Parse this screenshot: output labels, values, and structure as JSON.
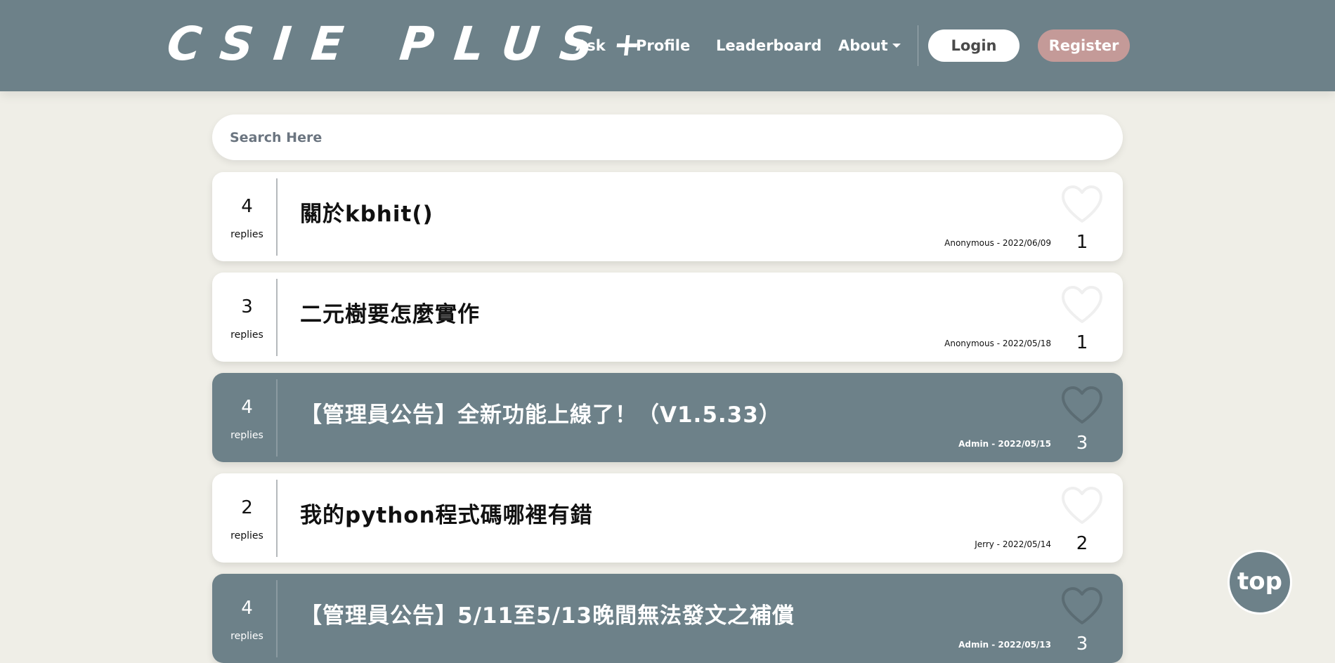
{
  "header": {
    "logo_text": "CSIE PLUS",
    "logo_plus": "+",
    "nav": [
      {
        "label": "Ask"
      },
      {
        "label": "Profile"
      },
      {
        "label": "Leaderboard"
      },
      {
        "label": "About"
      }
    ],
    "login_label": "Login",
    "register_label": "Register"
  },
  "search": {
    "placeholder": "Search Here",
    "value": ""
  },
  "replies_label": "replies",
  "posts": [
    {
      "replies": "4",
      "title": "關於kbhit()",
      "author": "Anonymous",
      "date": "2022/06/09",
      "meta": "Anonymous - 2022/06/09",
      "likes": "1",
      "is_admin": false
    },
    {
      "replies": "3",
      "title": "二元樹要怎麼實作",
      "author": "Anonymous",
      "date": "2022/05/18",
      "meta": "Anonymous - 2022/05/18",
      "likes": "1",
      "is_admin": false
    },
    {
      "replies": "4",
      "title": "【管理員公告】全新功能上線了！（V1.5.33）",
      "author": "Admin",
      "date": "2022/05/15",
      "meta": "Admin - 2022/05/15",
      "likes": "3",
      "is_admin": true
    },
    {
      "replies": "2",
      "title": "我的python程式碼哪裡有錯",
      "author": "Jerry",
      "date": "2022/05/14",
      "meta": "Jerry - 2022/05/14",
      "likes": "2",
      "is_admin": false
    },
    {
      "replies": "4",
      "title": "【管理員公告】5/11至5/13晚間無法發文之補償",
      "author": "Admin",
      "date": "2022/05/13",
      "meta": "Admin - 2022/05/13",
      "likes": "3",
      "is_admin": true
    }
  ],
  "top_button_label": "top",
  "icons": {
    "like": "heart-outline-icon",
    "dropdown": "caret-down-icon"
  },
  "colors": {
    "header_bg": "#6d8189",
    "page_bg": "#efeee7",
    "card_bg": "#ffffff",
    "admin_card_bg": "#6d8189",
    "register_bg": "#c49a98"
  }
}
